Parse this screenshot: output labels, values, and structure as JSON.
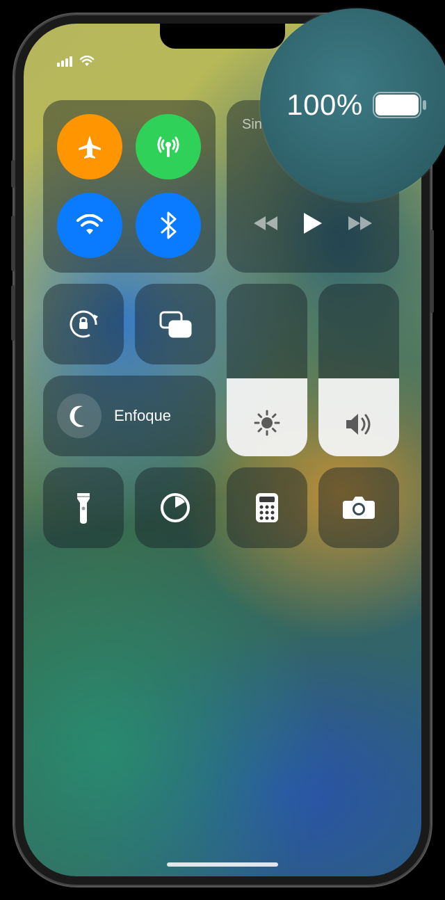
{
  "status": {
    "battery_percent": "100%",
    "battery_level": 100
  },
  "media": {
    "title": "Sin reproducción"
  },
  "focus": {
    "label": "Enfoque"
  },
  "sliders": {
    "brightness_percent": 45,
    "volume_percent": 45
  },
  "zoom": {
    "battery_percent": "100%"
  },
  "controls": {
    "airplane": "Modo avión",
    "cellular": "Datos móviles",
    "wifi": "Wi-Fi",
    "bluetooth": "Bluetooth",
    "orientation_lock": "Bloqueo de rotación",
    "screen_mirror": "Duplicar pantalla",
    "flashlight": "Linterna",
    "timer": "Temporizador",
    "calculator": "Calculadora",
    "camera": "Cámara"
  }
}
